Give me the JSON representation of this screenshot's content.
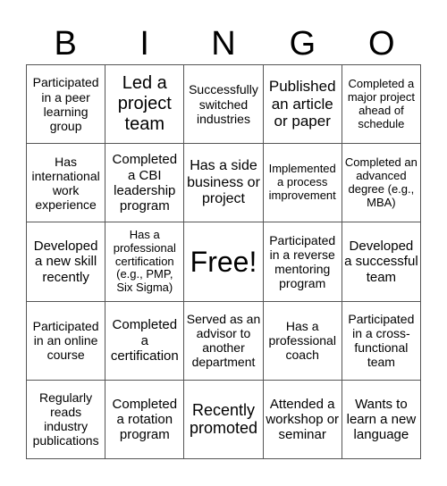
{
  "header": [
    "B",
    "I",
    "N",
    "G",
    "O"
  ],
  "cells": [
    "Participated in a peer learning group",
    "Led a project team",
    "Successfully switched industries",
    "Published an article or paper",
    "Completed a major project ahead of schedule",
    "Has international work experience",
    "Completed a CBI leadership program",
    "Has a side business or project",
    "Implemented a process improvement",
    "Completed an advanced degree (e.g., MBA)",
    "Developed a new skill recently",
    "Has a professional certification (e.g., PMP, Six Sigma)",
    "Free!",
    "Participated in a reverse mentoring program",
    "Developed a successful team",
    "Participated in an online course",
    "Completed a certification",
    "Served as an advisor to another department",
    "Has a professional coach",
    "Participated in a cross-functional team",
    "Regularly reads industry publications",
    "Completed a rotation program",
    "Recently promoted",
    "Attended a workshop or seminar",
    "Wants to learn a new language"
  ]
}
